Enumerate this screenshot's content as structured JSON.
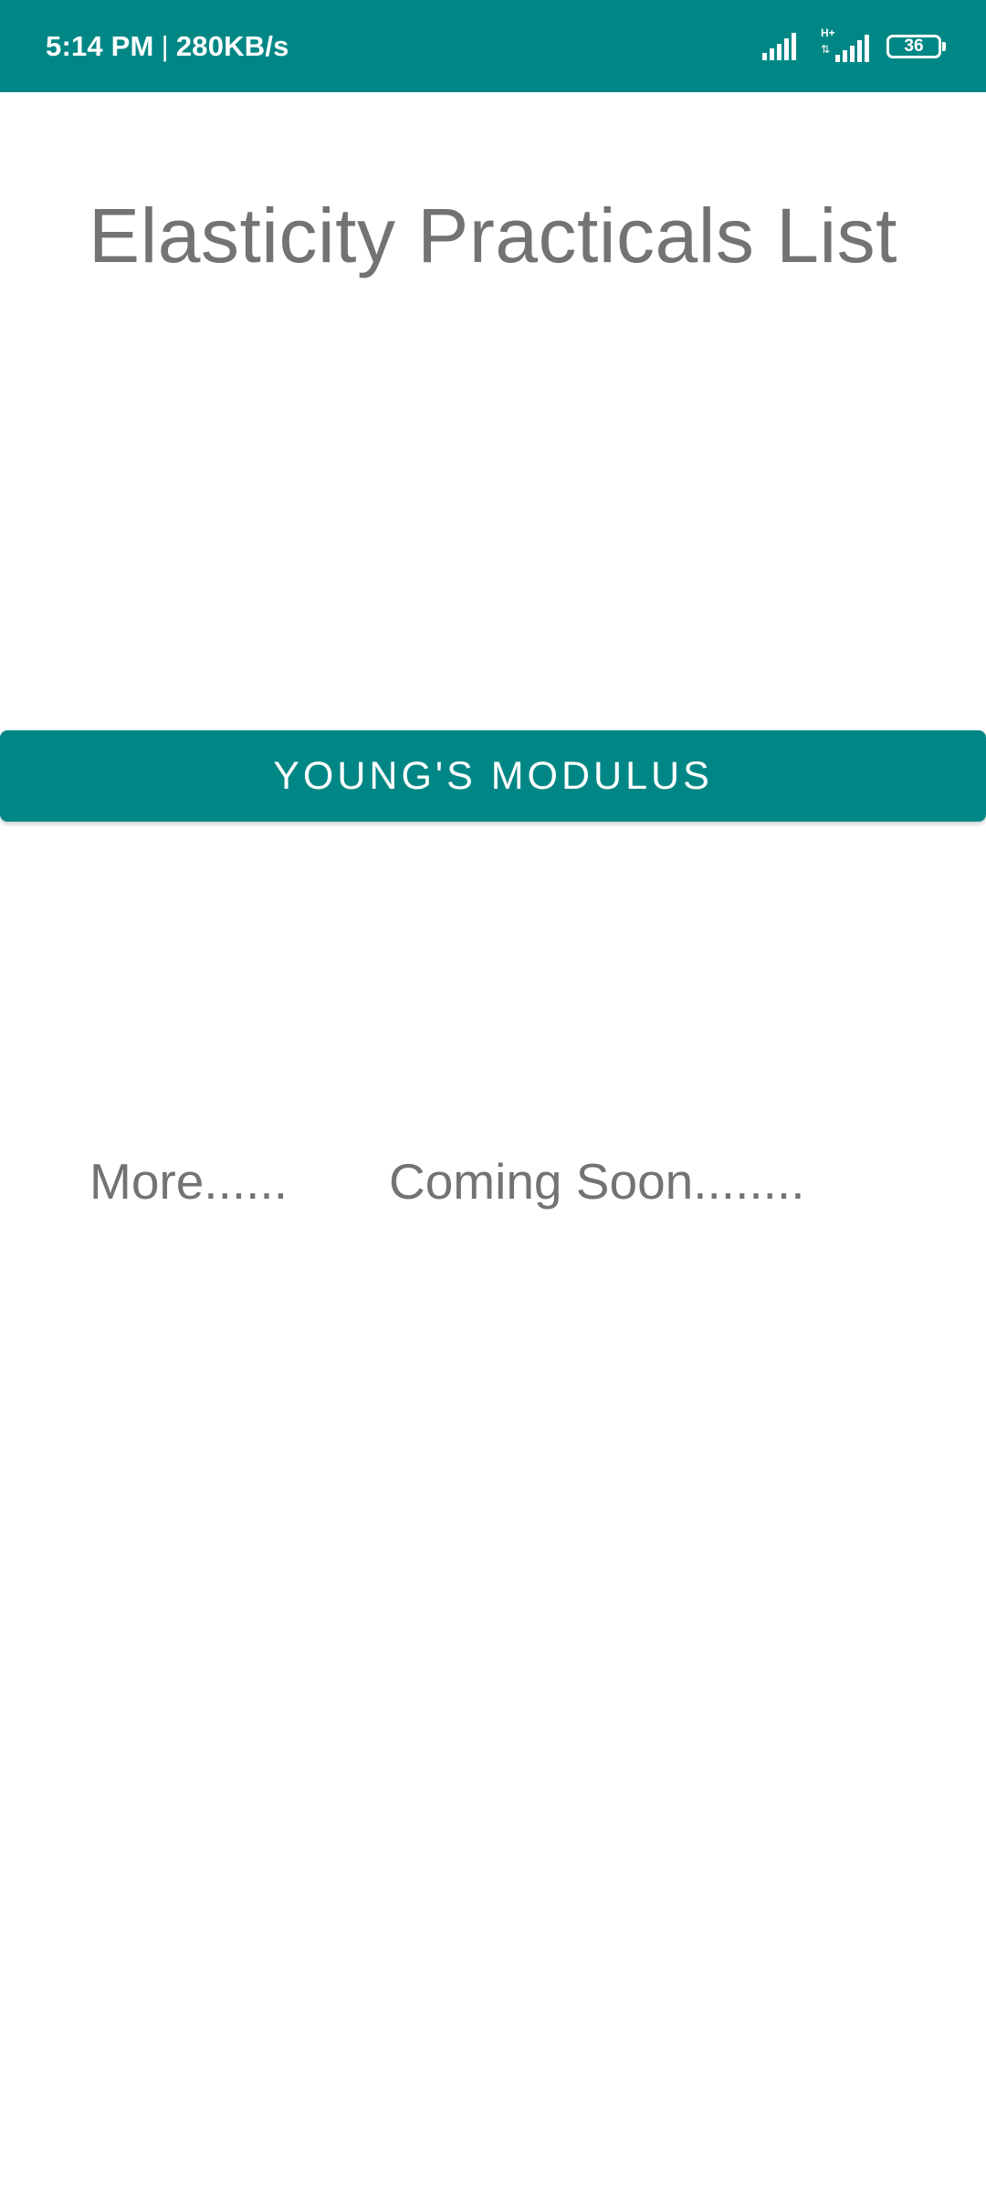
{
  "status_bar": {
    "time": "5:14 PM",
    "separator": "|",
    "speed": "280KB/s",
    "network_type": "H+",
    "data_arrows": "⇅",
    "battery_level": "36",
    "background_color": "#008785"
  },
  "screen": {
    "title": "Elasticity Practicals List",
    "practicals": [
      {
        "label": "YOUNG'S MODULUS"
      }
    ],
    "more_text": "More......",
    "coming_soon_text": "Coming Soon........"
  },
  "colors": {
    "accent": "#008785",
    "text_gray": "#737373",
    "background": "#ffffff"
  },
  "icons": {
    "signal_1": "signal-strength-icon",
    "signal_2": "signal-strength-icon",
    "battery": "battery-icon"
  }
}
